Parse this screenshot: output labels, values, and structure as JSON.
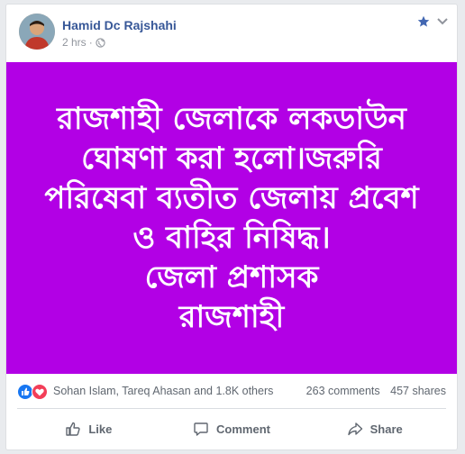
{
  "post": {
    "author": "Hamid Dc Rajshahi",
    "time": "2 hrs",
    "separator": "·",
    "visibility_icon": "globe-icon",
    "favorite_icon": "star-icon",
    "menu_icon": "chevron-down-icon",
    "background_color": "#b200e5",
    "image_text": "রাজশাহী জেলাকে লকডাউন\nঘোষণা করা হলো।জরুরি\nপরিষেবা ব্যতীত জেলায় প্রবেশ\nও বাহির নিষিদ্ধ।\nজেলা প্রশাসক\nরাজশাহী"
  },
  "stats": {
    "reaction_icons": [
      "like-reaction-icon",
      "love-reaction-icon"
    ],
    "reaction_names": "Sohan Islam, Tareq Ahasan and 1.8K others",
    "comments": "263 comments",
    "shares": "457 shares"
  },
  "actions": {
    "like": "Like",
    "comment": "Comment",
    "share": "Share"
  },
  "colors": {
    "author_link": "#385898",
    "like_blue": "#1877f2",
    "love_red": "#f33e58"
  }
}
